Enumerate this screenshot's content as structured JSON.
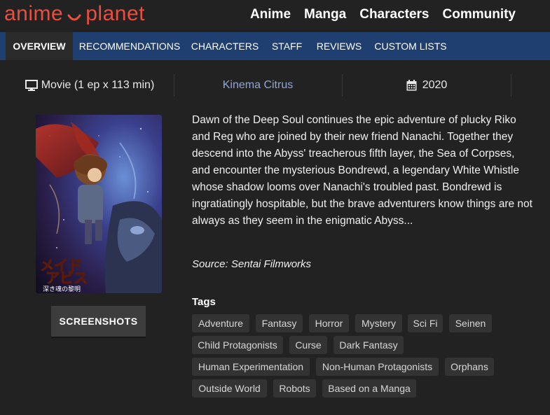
{
  "header": {
    "logo_left": "anime",
    "logo_right": "planet",
    "nav": [
      "Anime",
      "Manga",
      "Characters",
      "Community"
    ]
  },
  "tabs": [
    "OVERVIEW",
    "RECOMMENDATIONS",
    "CHARACTERS",
    "STAFF",
    "REVIEWS",
    "CUSTOM LISTS"
  ],
  "meta": {
    "type": "Movie (1 ep x 113 min)",
    "studio": "Kinema Citrus",
    "year": "2020"
  },
  "poster": {
    "title_jp_1": "メイド",
    "title_jp_2": "アビス",
    "subtitle_jp": "深き魂の黎明"
  },
  "screenshots_label": "SCREENSHOTS",
  "synopsis": "Dawn of the Deep Soul continues the epic adventure of plucky Riko and Reg who are joined by their new friend Nanachi. Together they descend into the Abyss' treacherous fifth layer, the Sea of Corpses, and encounter the mysterious Bondrewd, a legendary White Whistle whose shadow looms over Nanachi's troubled past. Bondrewd is ingratiatingly hospitable, but the brave adventurers know things are not always as they seem in the enigmatic Abyss...",
  "source": "Source: Sentai Filmworks",
  "tags_title": "Tags",
  "tags": [
    "Adventure",
    "Fantasy",
    "Horror",
    "Mystery",
    "Sci Fi",
    "Seinen",
    "Child Protagonists",
    "Curse",
    "Dark Fantasy",
    "Human Experimentation",
    "Non-Human Protagonists",
    "Orphans",
    "Outside World",
    "Robots",
    "Based on a Manga"
  ],
  "colors": {
    "accent": "#e94e3f",
    "tabbar": "#1e3f70",
    "studio_link": "#8fa6d6"
  },
  "icons": {
    "type": "monitor-icon",
    "year": "calendar-icon"
  }
}
